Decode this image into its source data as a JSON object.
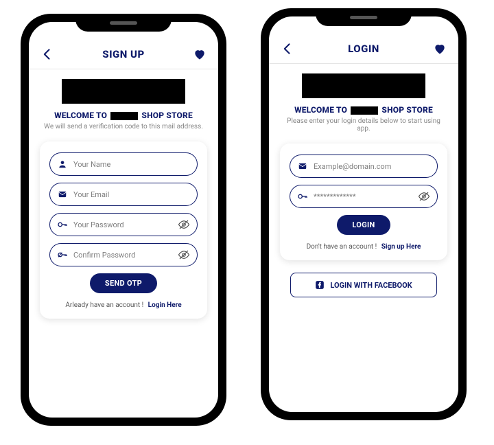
{
  "signup": {
    "title": "SIGN UP",
    "welcome_prefix": "WELCOME TO ",
    "welcome_suffix": " SHOP STORE",
    "subtext": "We will send a verification code to this mail address.",
    "name_placeholder": "Your Name",
    "email_placeholder": "Your Email",
    "password_placeholder": "Your Password",
    "confirm_placeholder": "Confirm Password",
    "button": "SEND OTP",
    "footer_text": "Arleady have an account !",
    "footer_link": "Login Here"
  },
  "login": {
    "title": "LOGIN",
    "welcome_prefix": "WELCOME TO ",
    "welcome_suffix": " SHOP STORE",
    "subtext": "Please enter your login details below to start using app.",
    "email_placeholder": "Example@domain.com",
    "password_value": "*************",
    "button": "LOGIN",
    "footer_text": "Don't have an account !",
    "footer_link": "Sign up Here",
    "facebook_button": "LOGIN WITH FACEBOOK"
  }
}
